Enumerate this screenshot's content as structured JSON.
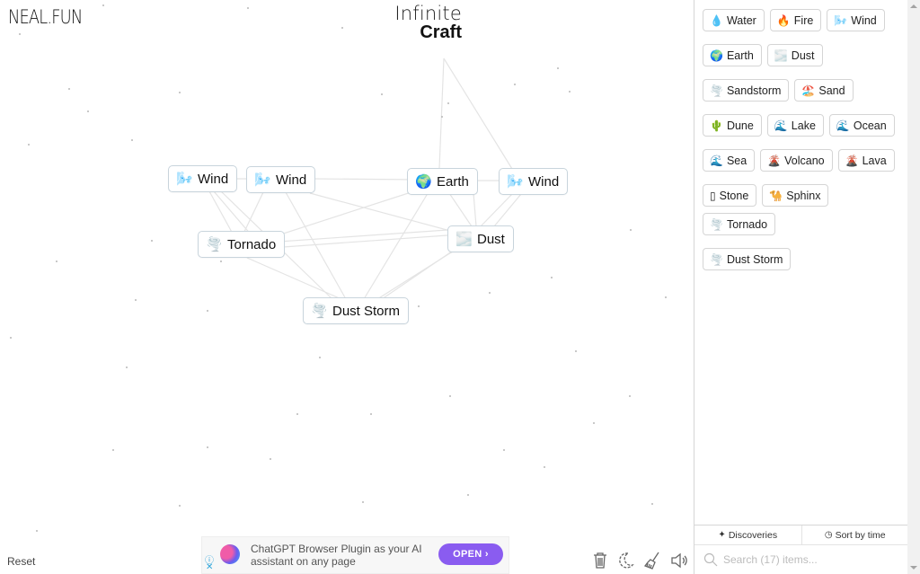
{
  "header": {
    "logo": "NEAL.FUN",
    "title_line1": "Infinite",
    "title_line2": "Craft"
  },
  "canvas": {
    "nodes": [
      {
        "id": "n1",
        "label": "Wind",
        "icon": "wind-icon",
        "emoji": "🌬️"
      },
      {
        "id": "n2",
        "label": "Wind",
        "icon": "wind-icon",
        "emoji": "🌬️"
      },
      {
        "id": "n3",
        "label": "Earth",
        "icon": "earth-icon",
        "emoji": "🌍"
      },
      {
        "id": "n4",
        "label": "Wind",
        "icon": "wind-icon",
        "emoji": "🌬️"
      },
      {
        "id": "n5",
        "label": "Tornado",
        "icon": "tornado-icon",
        "emoji": "🌪️"
      },
      {
        "id": "n6",
        "label": "Dust",
        "icon": "dust-icon",
        "emoji": "🌫️"
      },
      {
        "id": "n7",
        "label": "Dust Storm",
        "icon": "tornado-icon",
        "emoji": "🌪️"
      }
    ],
    "reset_label": "Reset"
  },
  "ad": {
    "text": "ChatGPT Browser Plugin as your AI assistant on any page",
    "button_label": "OPEN ›",
    "info_icon": "ⓘ",
    "close_icon": "✕"
  },
  "toolbar": {
    "icons": [
      "trash-icon",
      "moon-icon",
      "broom-icon",
      "speaker-icon"
    ]
  },
  "sidebar": {
    "items": [
      {
        "label": "Water",
        "emoji": "💧",
        "icon": "water-drop-icon"
      },
      {
        "label": "Fire",
        "emoji": "🔥",
        "icon": "fire-icon"
      },
      {
        "label": "Wind",
        "emoji": "🌬️",
        "icon": "wind-icon"
      },
      {
        "label": "Earth",
        "emoji": "🌍",
        "icon": "earth-icon"
      },
      {
        "label": "Dust",
        "emoji": "🌫️",
        "icon": "dust-icon"
      },
      {
        "label": "Sandstorm",
        "emoji": "🌪️",
        "icon": "tornado-icon"
      },
      {
        "label": "Sand",
        "emoji": "🏖️",
        "icon": "beach-icon"
      },
      {
        "label": "Dune",
        "emoji": "🌵",
        "icon": "cactus-icon"
      },
      {
        "label": "Lake",
        "emoji": "🌊",
        "icon": "wave-icon"
      },
      {
        "label": "Ocean",
        "emoji": "🌊",
        "icon": "wave-icon"
      },
      {
        "label": "Sea",
        "emoji": "🌊",
        "icon": "wave-icon"
      },
      {
        "label": "Volcano",
        "emoji": "🌋",
        "icon": "volcano-icon"
      },
      {
        "label": "Lava",
        "emoji": "🌋",
        "icon": "volcano-icon"
      },
      {
        "label": "Stone",
        "emoji": "▯",
        "icon": "stone-icon"
      },
      {
        "label": "Sphinx",
        "emoji": "🐪",
        "icon": "camel-icon"
      },
      {
        "label": "Tornado",
        "emoji": "🌪️",
        "icon": "tornado-icon"
      },
      {
        "label": "Dust Storm",
        "emoji": "🌪️",
        "icon": "tornado-icon"
      }
    ],
    "discoveries_label": "Discoveries",
    "sort_label": "Sort by time",
    "search_placeholder": "Search (17) items..."
  }
}
